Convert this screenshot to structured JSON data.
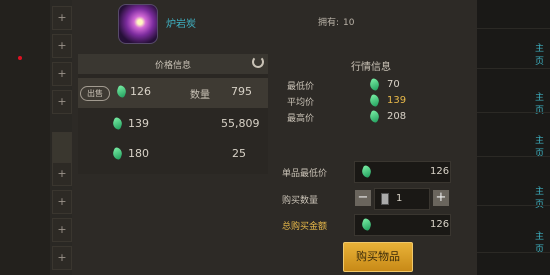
{
  "item": {
    "name": "炉岩炭",
    "owned_label": "拥有:",
    "owned_count": "10"
  },
  "price_list": {
    "title": "价格信息",
    "sell_label": "出售",
    "quantity_label": "数量",
    "rows": [
      {
        "price": "126",
        "quantity": "795"
      },
      {
        "price": "139",
        "quantity": "55,809"
      },
      {
        "price": "180",
        "quantity": "25"
      }
    ]
  },
  "market": {
    "title": "行情信息",
    "min_label": "最低价",
    "min": "70",
    "avg_label": "平均价",
    "avg": "139",
    "max_label": "最高价",
    "max": "208"
  },
  "buy": {
    "unit_label": "单品最低价",
    "unit_price": "126",
    "qty_label": "购买数量",
    "qty": "1",
    "total_label": "总购买金额",
    "total": "126",
    "button": "购买物品",
    "minus": "−",
    "plus": "+"
  },
  "sidebar": {
    "plus_glyph": "+"
  },
  "right_strip": {
    "tag": "主页"
  },
  "colors": {
    "accent": "#3fb3c4",
    "gold": "#e8b94a",
    "gem": "#3ed38a"
  }
}
